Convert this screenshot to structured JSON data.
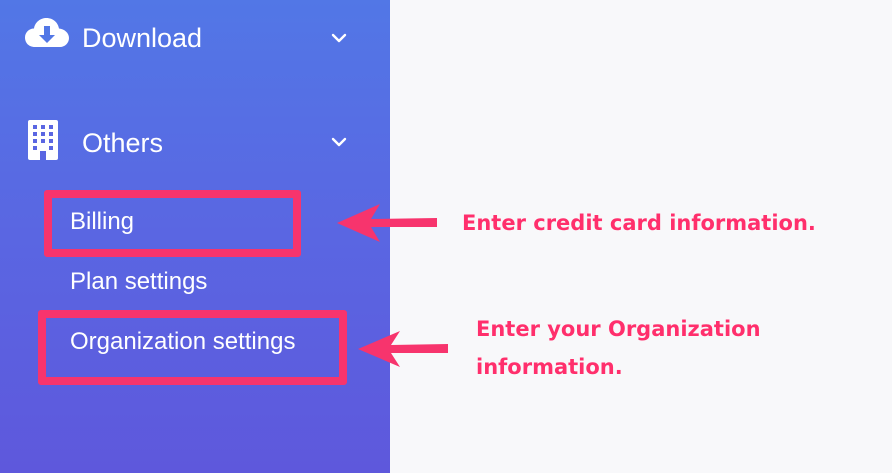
{
  "sidebar": {
    "sections": [
      {
        "label": "Download",
        "icon": "cloud-download-icon"
      },
      {
        "label": "Others",
        "icon": "building-icon"
      }
    ],
    "others_items": [
      {
        "label": "Billing"
      },
      {
        "label": "Plan settings"
      },
      {
        "label": "Organization settings"
      }
    ]
  },
  "annotations": {
    "billing_note": "Enter credit card information.",
    "organization_note_line1": "Enter your Organization",
    "organization_note_line2": "information."
  },
  "colors": {
    "sidebar_top": "#5277e6",
    "sidebar_bottom": "#5e58dc",
    "annotation": "#f7346d",
    "content_bg": "#f8f8fa"
  }
}
